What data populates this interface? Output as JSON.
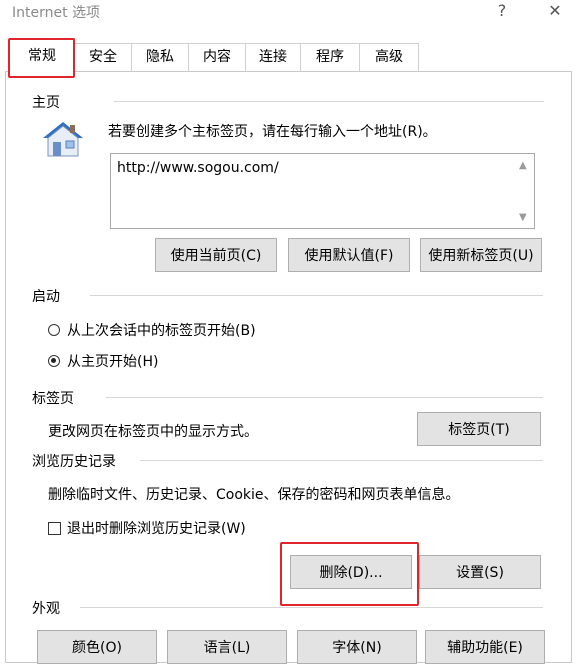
{
  "window": {
    "title": "Internet 选项",
    "help_label": "?",
    "close_label": "✕"
  },
  "tabs": [
    {
      "label": "常规",
      "active": true
    },
    {
      "label": "安全"
    },
    {
      "label": "隐私"
    },
    {
      "label": "内容"
    },
    {
      "label": "连接"
    },
    {
      "label": "程序"
    },
    {
      "label": "高级"
    }
  ],
  "homepage": {
    "section_label": "主页",
    "instruction": "若要创建多个主标签页，请在每行输入一个地址(R)。",
    "url_value": "http://www.sogou.com/",
    "buttons": [
      "使用当前页(C)",
      "使用默认值(F)",
      "使用新标签页(U)"
    ]
  },
  "startup": {
    "section_label": "启动",
    "options": [
      {
        "label": "从上次会话中的标签页开始(B)",
        "selected": false
      },
      {
        "label": "从主页开始(H)",
        "selected": true
      }
    ]
  },
  "tabs_section": {
    "section_label": "标签页",
    "description": "更改网页在标签页中的显示方式。",
    "button": "标签页(T)"
  },
  "history": {
    "section_label": "浏览历史记录",
    "description": "删除临时文件、历史记录、Cookie、保存的密码和网页表单信息。",
    "checkbox_label": "退出时删除浏览历史记录(W)",
    "checkbox_checked": false,
    "delete_button": "删除(D)...",
    "settings_button": "设置(S)"
  },
  "appearance": {
    "section_label": "外观",
    "buttons": [
      "颜色(O)",
      "语言(L)",
      "字体(N)",
      "辅助功能(E)"
    ]
  },
  "colors": {
    "highlight_red": "#e0262b",
    "button_bg": "#e3e3e3"
  }
}
